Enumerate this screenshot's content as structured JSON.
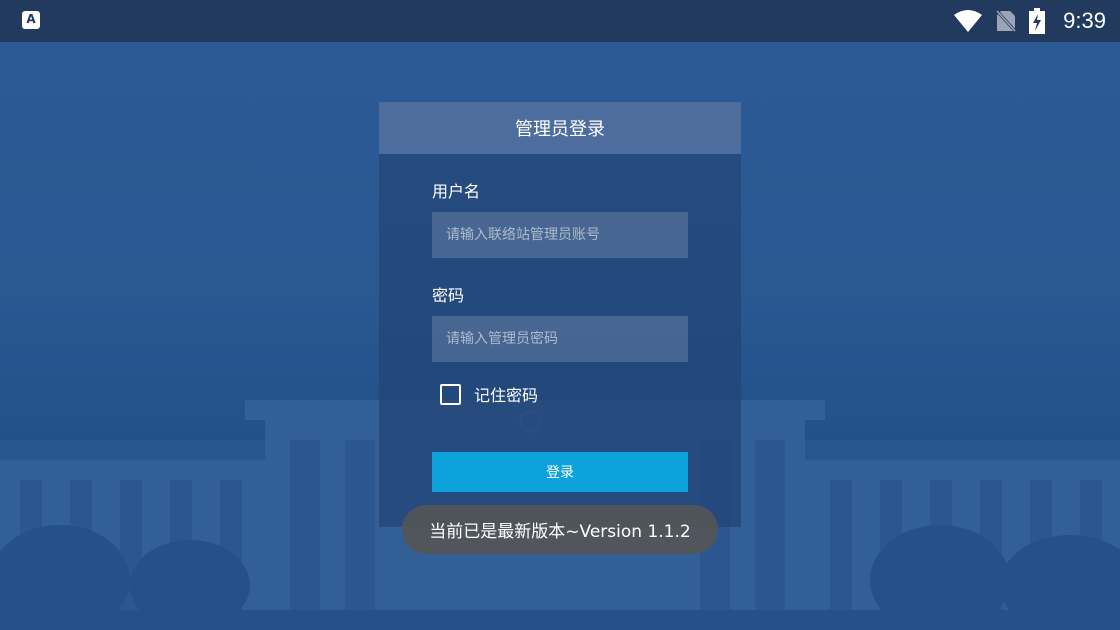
{
  "status_bar": {
    "app_badge": "A",
    "time": "9:39",
    "icons": [
      "wifi-icon",
      "no-sim-icon",
      "battery-charging-icon"
    ]
  },
  "login": {
    "title": "管理员登录",
    "username": {
      "label": "用户名",
      "placeholder": "请输入联络站管理员账号",
      "value": ""
    },
    "password": {
      "label": "密码",
      "placeholder": "请输入管理员密码",
      "value": ""
    },
    "remember": {
      "label": "记住密码",
      "checked": false
    },
    "submit_label": "登录"
  },
  "toast": {
    "message": "当前已是最新版本~Version 1.1.2"
  },
  "colors": {
    "background": "#2a5891",
    "status_bar": "#213a5d",
    "card_header": "#4d6d9f",
    "button": "#0ea2dd"
  }
}
